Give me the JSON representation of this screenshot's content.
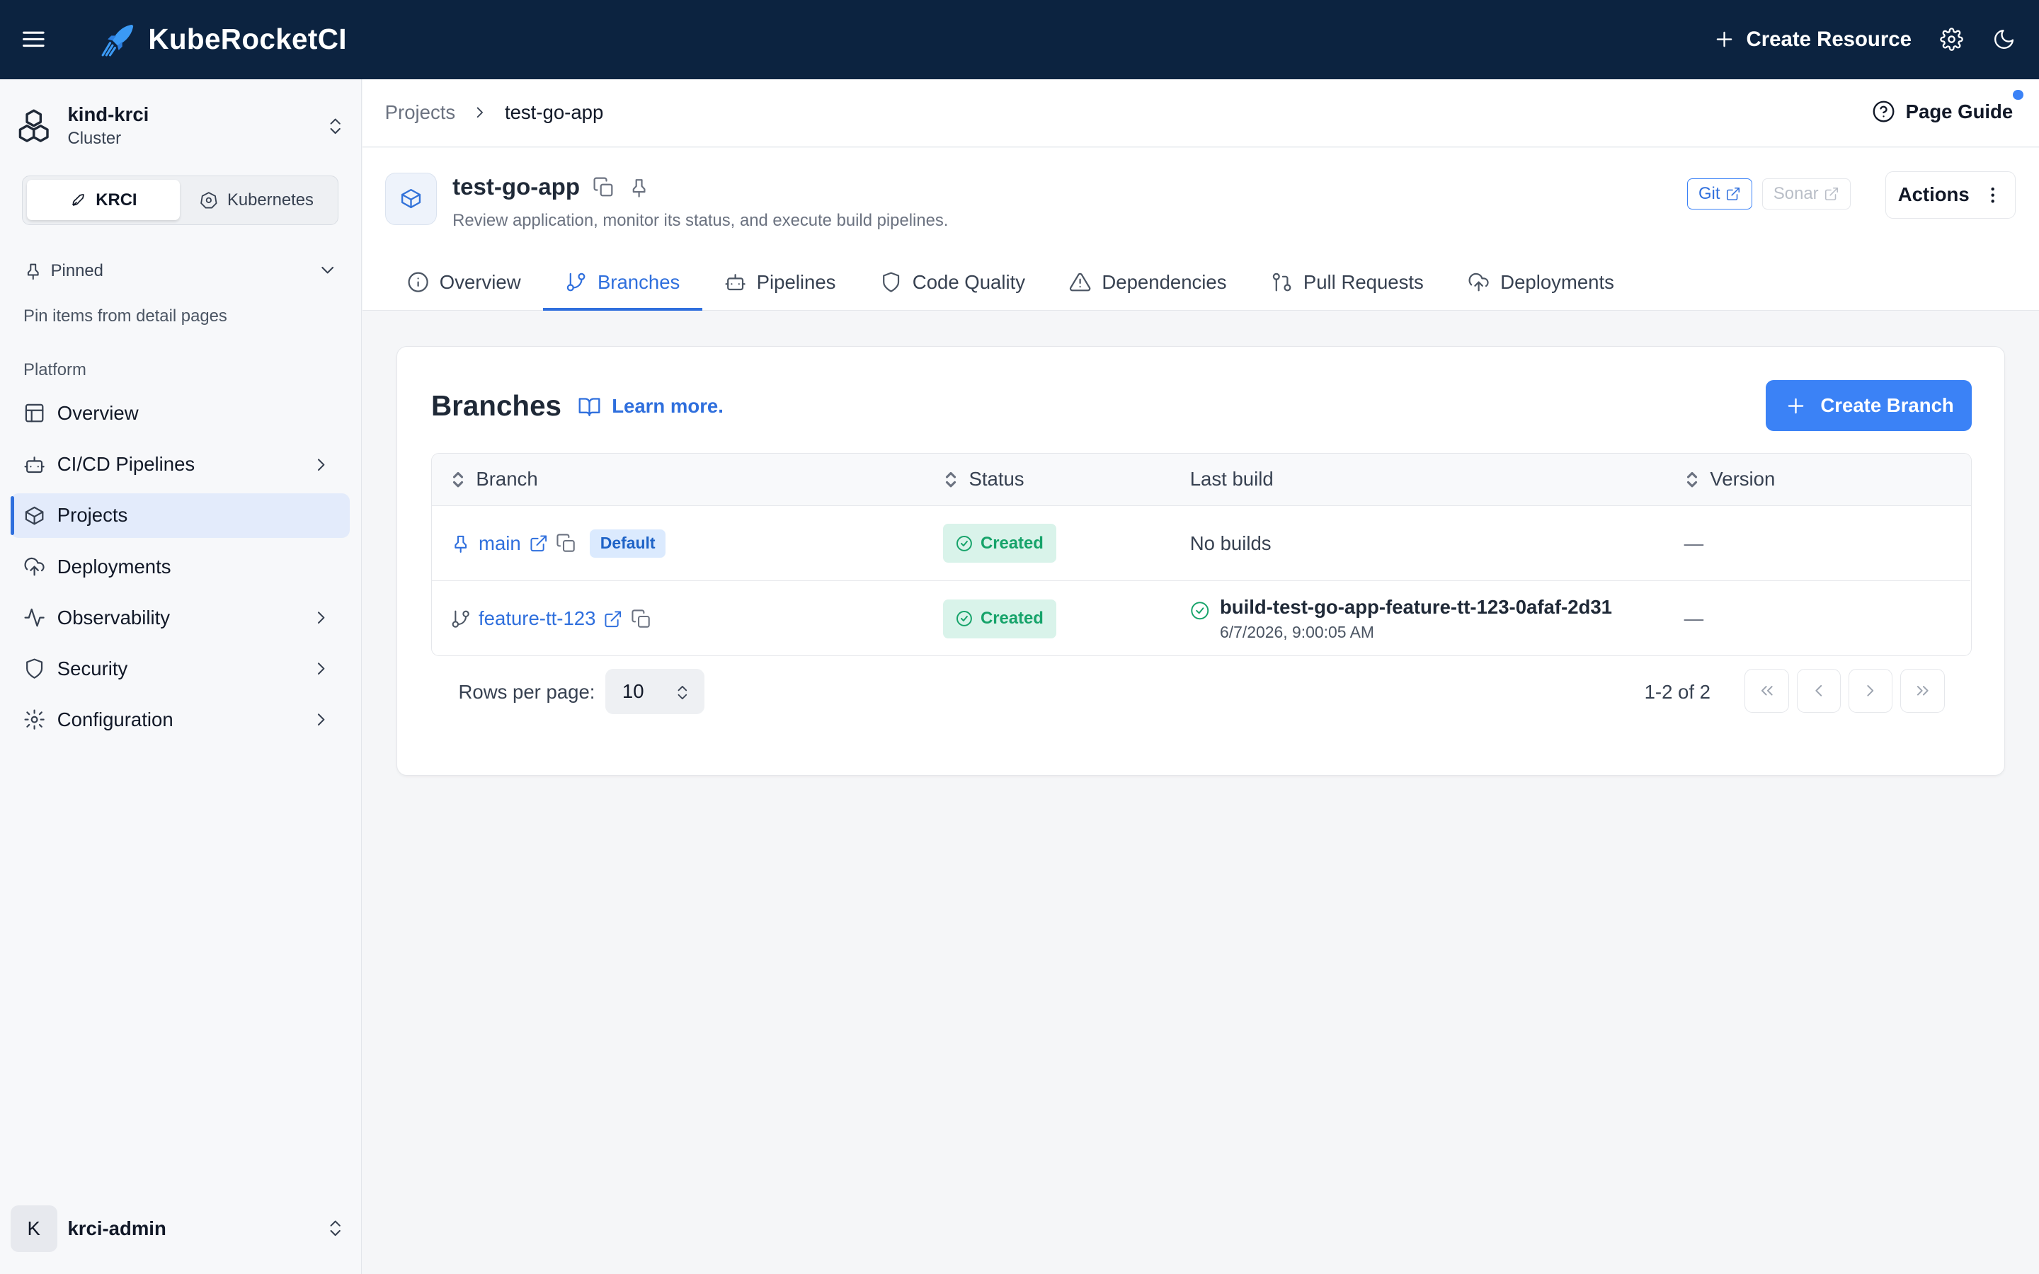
{
  "app": {
    "name": "KubeRocketCI"
  },
  "topbar": {
    "create_resource": "Create Resource"
  },
  "sidebar": {
    "cluster": {
      "name": "kind-krci",
      "type": "Cluster"
    },
    "modes": [
      "KRCI",
      "Kubernetes"
    ],
    "active_mode": "KRCI",
    "pinned": {
      "label": "Pinned",
      "hint": "Pin items from detail pages"
    },
    "section": "Platform",
    "items": [
      {
        "label": "Overview",
        "icon": "layout-icon",
        "expandable": false,
        "active": false
      },
      {
        "label": "CI/CD Pipelines",
        "icon": "bot-icon",
        "expandable": true,
        "active": false
      },
      {
        "label": "Projects",
        "icon": "box-icon",
        "expandable": false,
        "active": true
      },
      {
        "label": "Deployments",
        "icon": "cloud-upload-icon",
        "expandable": false,
        "active": false
      },
      {
        "label": "Observability",
        "icon": "activity-icon",
        "expandable": true,
        "active": false
      },
      {
        "label": "Security",
        "icon": "shield-icon",
        "expandable": true,
        "active": false
      },
      {
        "label": "Configuration",
        "icon": "gear-icon",
        "expandable": true,
        "active": false
      }
    ],
    "user": {
      "initial": "K",
      "name": "krci-admin"
    }
  },
  "breadcrumb": {
    "parent": "Projects",
    "current": "test-go-app",
    "page_guide": "Page Guide"
  },
  "project": {
    "name": "test-go-app",
    "description": "Review application, monitor its status, and execute build pipelines.",
    "links": {
      "git": "Git",
      "sonar": "Sonar"
    },
    "actions": "Actions"
  },
  "tabs": [
    {
      "label": "Overview",
      "icon": "info-icon",
      "active": false
    },
    {
      "label": "Branches",
      "icon": "git-branch-icon",
      "active": true
    },
    {
      "label": "Pipelines",
      "icon": "bot-icon",
      "active": false
    },
    {
      "label": "Code Quality",
      "icon": "shield-icon",
      "active": false
    },
    {
      "label": "Dependencies",
      "icon": "alert-triangle-icon",
      "active": false
    },
    {
      "label": "Pull Requests",
      "icon": "git-pull-request-icon",
      "active": false
    },
    {
      "label": "Deployments",
      "icon": "cloud-upload-icon",
      "active": false
    }
  ],
  "branches": {
    "title": "Branches",
    "learn_more": "Learn more.",
    "create_button": "Create Branch",
    "columns": {
      "branch": "Branch",
      "status": "Status",
      "last_build": "Last build",
      "version": "Version"
    },
    "rows": [
      {
        "name": "main",
        "default_badge": "Default",
        "status": "Created",
        "last_build": "No builds",
        "build_time": "",
        "version": "—"
      },
      {
        "name": "feature-tt-123",
        "default_badge": "",
        "status": "Created",
        "last_build": "build-test-go-app-feature-tt-123-0afaf-2d31",
        "build_time": "6/7/2026, 9:00:05 AM",
        "version": "—"
      }
    ],
    "pagination": {
      "rows_per_page_label": "Rows per page:",
      "rows_per_page": "10",
      "range": "1-2 of 2"
    }
  },
  "colors": {
    "topbar": "#0c2340",
    "accent": "#3b82f6",
    "success": "#16a36a"
  }
}
